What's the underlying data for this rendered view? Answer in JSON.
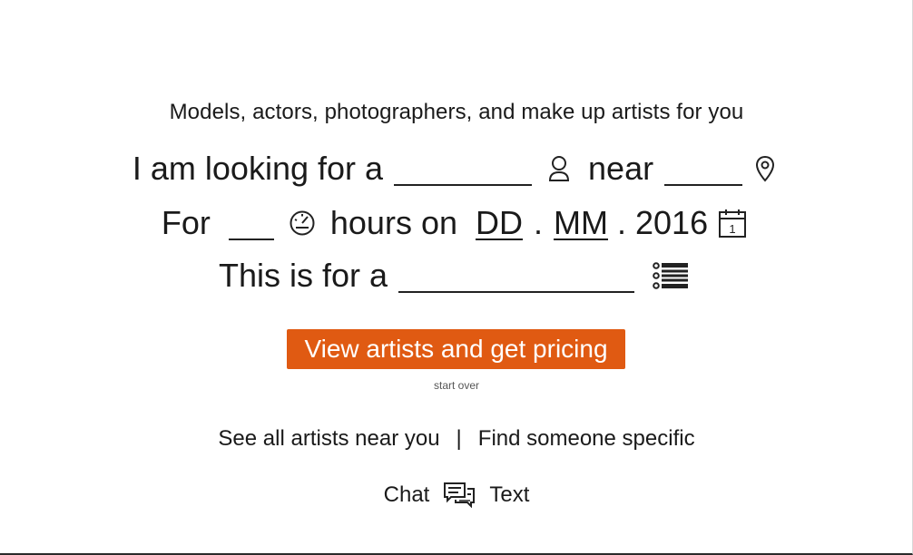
{
  "tagline": "Models, actors, photographers, and make up artists for you",
  "form": {
    "line1_prefix": "I am looking for a",
    "line1_near": "near",
    "line2_prefix": "For",
    "line2_hours": "hours on",
    "day_placeholder": "DD",
    "dot": ".",
    "month_placeholder": "MM",
    "year": ". 2016",
    "line3_prefix": "This is for a"
  },
  "icons": {
    "person": "user-icon",
    "location": "location-pin-icon",
    "hours": "speedometer-icon",
    "date": "calendar-icon",
    "calendar_day": "1",
    "purpose": "list-icon",
    "chat": "chat-bubbles-icon"
  },
  "cta": {
    "label": "View artists and get pricing"
  },
  "start_over": "start over",
  "links": {
    "see_all": "See all artists near you",
    "separator": "|",
    "find_specific": "Find someone specific"
  },
  "contact": {
    "chat": "Chat",
    "text": "Text"
  },
  "colors": {
    "accent": "#e05a12"
  }
}
